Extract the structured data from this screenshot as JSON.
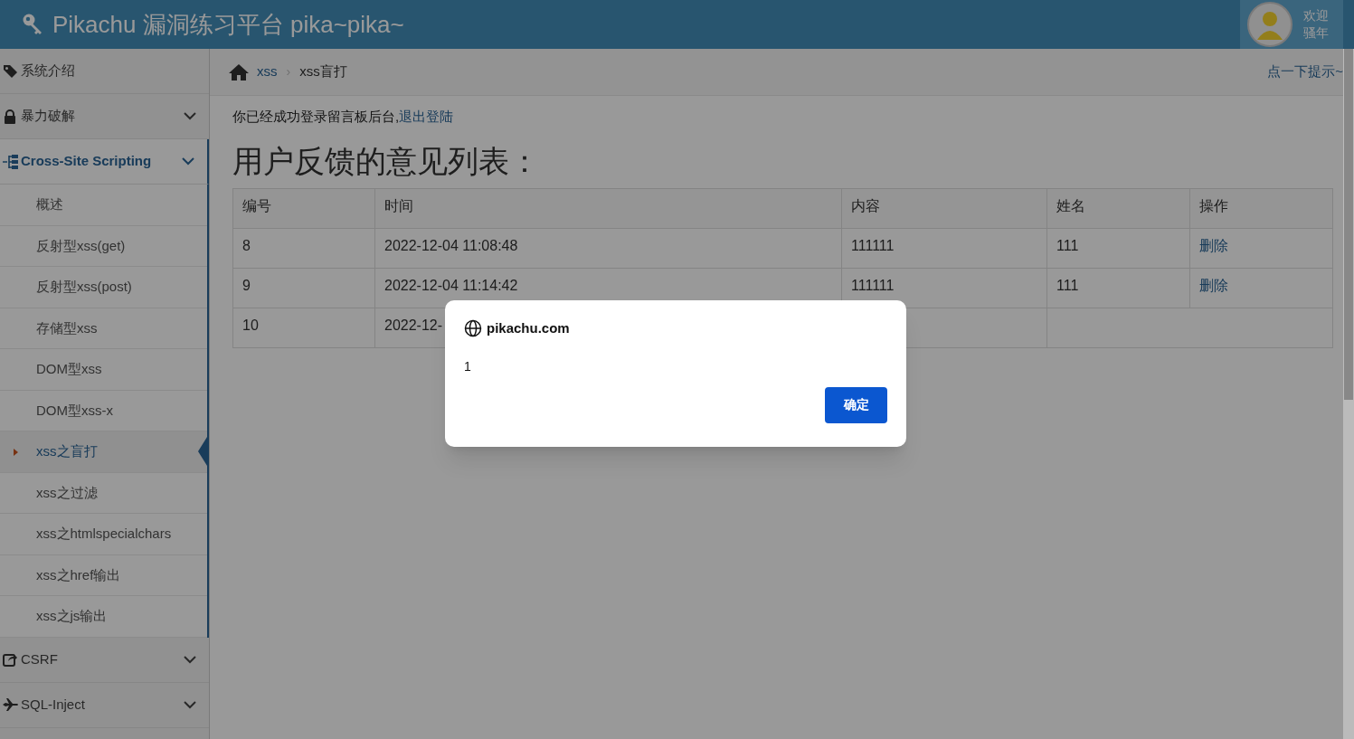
{
  "header": {
    "title": "Pikachu 漏洞练习平台 pika~pika~",
    "welcome": "欢迎",
    "user": "骚年"
  },
  "sidebar": {
    "items": [
      {
        "label": "系统介绍",
        "kind": "link",
        "expanded": false
      },
      {
        "label": "暴力破解",
        "kind": "menu",
        "expanded": false
      },
      {
        "label": "Cross-Site Scripting",
        "kind": "menu",
        "expanded": true,
        "children": [
          {
            "label": "概述",
            "selected": false
          },
          {
            "label": "反射型xss(get)",
            "selected": false
          },
          {
            "label": "反射型xss(post)",
            "selected": false
          },
          {
            "label": "存储型xss",
            "selected": false
          },
          {
            "label": "DOM型xss",
            "selected": false
          },
          {
            "label": "DOM型xss-x",
            "selected": false
          },
          {
            "label": "xss之盲打",
            "selected": true
          },
          {
            "label": "xss之过滤",
            "selected": false
          },
          {
            "label": "xss之htmlspecialchars",
            "selected": false
          },
          {
            "label": "xss之href输出",
            "selected": false
          },
          {
            "label": "xss之js输出",
            "selected": false
          }
        ]
      },
      {
        "label": "CSRF",
        "kind": "menu",
        "expanded": false
      },
      {
        "label": "SQL-Inject",
        "kind": "menu",
        "expanded": false
      }
    ]
  },
  "breadcrumb": {
    "items": [
      "xss",
      "xss盲打"
    ],
    "separator": "›",
    "hint": "点一下提示~"
  },
  "notice": {
    "text": "你已经成功登录留言板后台,",
    "link": "退出登陆"
  },
  "heading": "用户反馈的意见列表：",
  "table": {
    "columns": [
      "编号",
      "时间",
      "内容",
      "姓名",
      "操作"
    ],
    "rows": [
      {
        "cells": [
          "8",
          "2022-12-04 11:08:48",
          "111111",
          "111"
        ],
        "action": "删除"
      },
      {
        "cells": [
          "9",
          "2022-12-04 11:14:42",
          "111111",
          "111"
        ],
        "action": "删除"
      },
      {
        "cells": [
          "10",
          "2022-12-"
        ]
      }
    ]
  },
  "dialog": {
    "site": "pikachu.com",
    "message": "1",
    "button": "确定"
  }
}
